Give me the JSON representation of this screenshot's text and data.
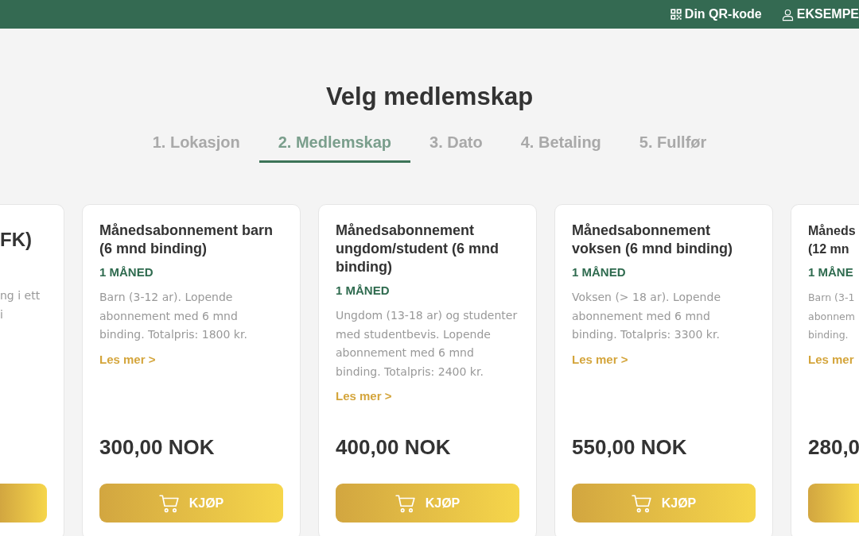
{
  "header": {
    "qr_label": "Din QR-kode",
    "user_label": "EKSEMPE"
  },
  "page_title": "Velg medlemskap",
  "steps": [
    {
      "label": "1. Lokasjon",
      "selected": false
    },
    {
      "label": "2. Medlemskap",
      "selected": true
    },
    {
      "label": "3. Dato",
      "selected": false
    },
    {
      "label": "4. Betaling",
      "selected": false
    },
    {
      "label": "5. Fullfør",
      "selected": false
    }
  ],
  "cards": [
    {
      "kind": "cut-left",
      "title_lines": [
        "FK)"
      ],
      "description_lines": [
        "ng i ett",
        "i"
      ]
    },
    {
      "kind": "full",
      "title": "Månedsabonnement barn (6 mnd binding)",
      "period": "1 MÅNED",
      "description": "Barn (3-12 ar). Lopende abonnement med 6 mnd binding. Totalpris: 1800 kr.",
      "link": "Les mer >",
      "price": "300,00 NOK",
      "button": "KJØP"
    },
    {
      "kind": "full",
      "title": "Månedsabonnement ungdom/student (6 mnd binding)",
      "period": "1 MÅNED",
      "description": "Ungdom (13-18 ar) og studenter med studentbevis. Lopende abonnement med 6 mnd binding. Totalpris: 2400 kr.",
      "link": "Les mer >",
      "price": "400,00 NOK",
      "button": "KJØP"
    },
    {
      "kind": "full",
      "title": "Månedsabonnement voksen (6 mnd binding)",
      "period": "1 MÅNED",
      "description": "Voksen (> 18 ar). Lopende abonnement med 6 mnd binding. Totalpris: 3300 kr.",
      "link": "Les mer >",
      "price": "550,00 NOK",
      "button": "KJØP"
    },
    {
      "kind": "cut-right",
      "title_lines": [
        "Måneds",
        "(12 mn"
      ],
      "period": "1 MÅNE",
      "description_lines": [
        "Barn (3-1",
        "abonnem",
        "binding."
      ],
      "link": "Les mer",
      "price": "280,0"
    }
  ]
}
